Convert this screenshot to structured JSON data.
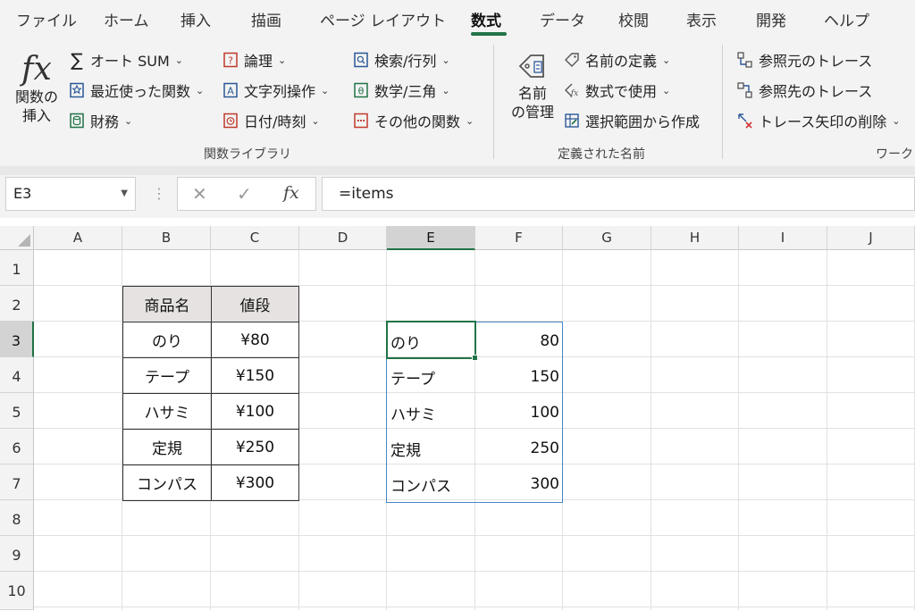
{
  "tabs": [
    {
      "label": "ファイル"
    },
    {
      "label": "ホーム"
    },
    {
      "label": "挿入"
    },
    {
      "label": "描画"
    },
    {
      "label": "ページ レイアウト"
    },
    {
      "label": "数式",
      "active": true
    },
    {
      "label": "データ"
    },
    {
      "label": "校閲"
    },
    {
      "label": "表示"
    },
    {
      "label": "開発"
    },
    {
      "label": "ヘルプ"
    }
  ],
  "ribbon": {
    "function_library": {
      "insert_function": {
        "line1": "関数の",
        "line2": "挿入"
      },
      "autosum": "オート SUM",
      "recent": "最近使った関数",
      "financial": "財務",
      "logical": "論理",
      "text": "文字列操作",
      "datetime": "日付/時刻",
      "lookup": "検索/行列",
      "math": "数学/三角",
      "more": "その他の関数",
      "label": "関数ライブラリ"
    },
    "defined_names": {
      "manager": {
        "line1": "名前",
        "line2": "の管理"
      },
      "define": "名前の定義",
      "use_in_formula": "数式で使用",
      "create_from_selection": "選択範囲から作成",
      "label": "定義された名前"
    },
    "auditing": {
      "trace_precedents": "参照元のトレース",
      "trace_dependents": "参照先のトレース",
      "remove_arrows": "トレース矢印の削除",
      "label": "ワーク"
    }
  },
  "formula_bar": {
    "name_box": "E3",
    "formula": "=items"
  },
  "grid": {
    "columns": [
      "A",
      "B",
      "C",
      "D",
      "E",
      "F",
      "G",
      "H",
      "I",
      "J"
    ],
    "selected_column": "E",
    "rows": [
      "1",
      "2",
      "3",
      "4",
      "5",
      "6",
      "7",
      "8",
      "9",
      "10"
    ],
    "selected_row": "3"
  },
  "table": {
    "headers": [
      "商品名",
      "値段"
    ],
    "rows": [
      [
        "のり",
        "¥80"
      ],
      [
        "テープ",
        "¥150"
      ],
      [
        "ハサミ",
        "¥100"
      ],
      [
        "定規",
        "¥250"
      ],
      [
        "コンパス",
        "¥300"
      ]
    ]
  },
  "spill": {
    "rows": [
      [
        "のり",
        "80"
      ],
      [
        "テープ",
        "150"
      ],
      [
        "ハサミ",
        "100"
      ],
      [
        "定規",
        "250"
      ],
      [
        "コンパス",
        "300"
      ]
    ]
  },
  "colors": {
    "accent": "#217346",
    "spill_border": "#4a86c5",
    "header_fill": "#e7e2e2"
  }
}
